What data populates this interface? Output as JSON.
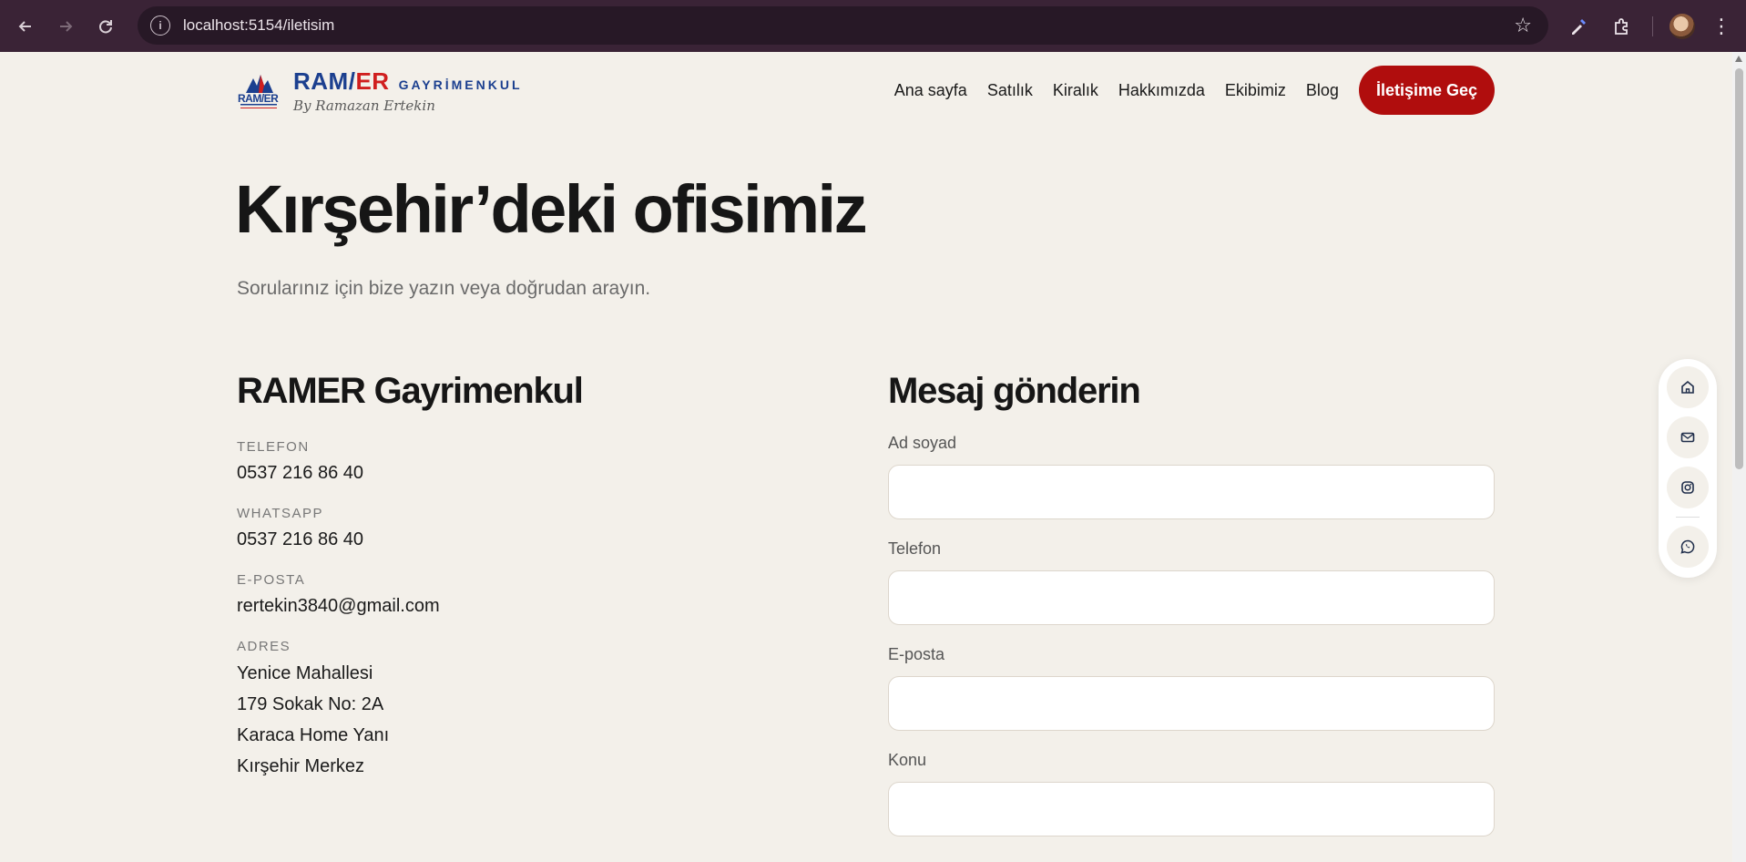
{
  "browser": {
    "url": "localhost:5154/iletisim"
  },
  "site": {
    "brand": {
      "ram": "RAM/",
      "er": "ER",
      "gayrimenkul": "GAYRİMENKUL",
      "by": "By Ramazan Ertekin",
      "mark_text": "RAM/ER"
    },
    "nav": [
      {
        "label": "Ana sayfa"
      },
      {
        "label": "Satılık"
      },
      {
        "label": "Kiralık"
      },
      {
        "label": "Hakkımızda"
      },
      {
        "label": "Ekibimiz"
      },
      {
        "label": "Blog"
      }
    ],
    "cta_label": "İletişime Geç",
    "colors": {
      "accent": "#b00d0d",
      "brand_blue": "#1b3f8f",
      "brand_red": "#d01f1f",
      "background": "#f3f0ea"
    }
  },
  "hero": {
    "title": "Kırşehir’deki ofisimiz",
    "subtitle": "Sorularınız için bize yazın veya doğrudan arayın."
  },
  "contact": {
    "title": "RAMER Gayrimenkul",
    "phone": {
      "label": "TELEFON",
      "value": "0537 216 86 40"
    },
    "whatsapp": {
      "label": "WHATSAPP",
      "value": "0537 216 86 40"
    },
    "email": {
      "label": "E-POSTA",
      "value": "rertekin3840@gmail.com"
    },
    "address": {
      "label": "ADRES",
      "lines": [
        "Yenice Mahallesi",
        "179 Sokak No: 2A",
        "Karaca Home Yanı",
        "Kırşehir Merkez"
      ]
    }
  },
  "form": {
    "title": "Mesaj gönderin",
    "fields": [
      {
        "label": "Ad soyad",
        "value": ""
      },
      {
        "label": "Telefon",
        "value": ""
      },
      {
        "label": "E-posta",
        "value": ""
      },
      {
        "label": "Konu",
        "value": ""
      }
    ]
  },
  "floating_bar": {
    "icons": [
      "home-icon",
      "mail-icon",
      "instagram-icon",
      "whatsapp-icon"
    ]
  }
}
